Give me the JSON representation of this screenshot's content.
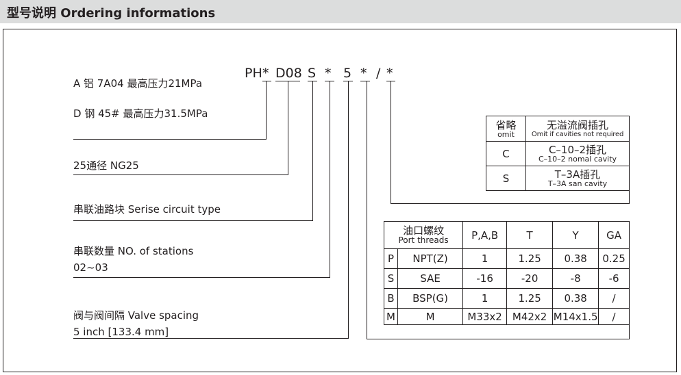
{
  "header": {
    "title": "型号说明  Ordering informations"
  },
  "code": {
    "c1": "PH",
    "c2": "*",
    "c3": "D08",
    "c4": "S",
    "c5": "*",
    "c6": "5",
    "c7": "*",
    "c8": "/",
    "c9": "*"
  },
  "labels": {
    "material_a": "A  铝 7A04 最高压力21MPa",
    "material_d": "D  钢 45# 最高压力31.5MPa",
    "size": "25通径  NG25",
    "circuit": "串联油路块 Serise circuit type",
    "stations_1": "串联数量  NO. of stations",
    "stations_2": "02~03",
    "spacing_1": "阀与阀间隔 Valve spacing",
    "spacing_2": "5 inch [133.4 mm]"
  },
  "cavity_table": {
    "header_col1_cn": "省略",
    "header_col1_en": "omit",
    "header_col2_cn": "无溢流阀插孔",
    "header_col2_en": "Omit if cavities not required",
    "rows": [
      {
        "code": "C",
        "cn": "C–10–2插孔",
        "en": "C–10–2 nomal cavity"
      },
      {
        "code": "S",
        "cn": "T–3A插孔",
        "en": "T–3A san cavity"
      }
    ]
  },
  "thread_table": {
    "header_cn": "油口螺纹",
    "header_en": "Port threads",
    "columns": [
      "P,A,B",
      "T",
      "Y",
      "GA"
    ],
    "rows": [
      {
        "code": "P",
        "name": "NPT(Z)",
        "values": [
          "1",
          "1.25",
          "0.38",
          "0.25"
        ]
      },
      {
        "code": "S",
        "name": "SAE",
        "values": [
          "-16",
          "-20",
          "-8",
          "-6"
        ]
      },
      {
        "code": "B",
        "name": "BSP(G)",
        "values": [
          "1",
          "1.25",
          "0.38",
          "/"
        ]
      },
      {
        "code": "M",
        "name": "M",
        "values": [
          "M33x2",
          "M42x2",
          "M14x1.5",
          "/"
        ]
      }
    ]
  }
}
